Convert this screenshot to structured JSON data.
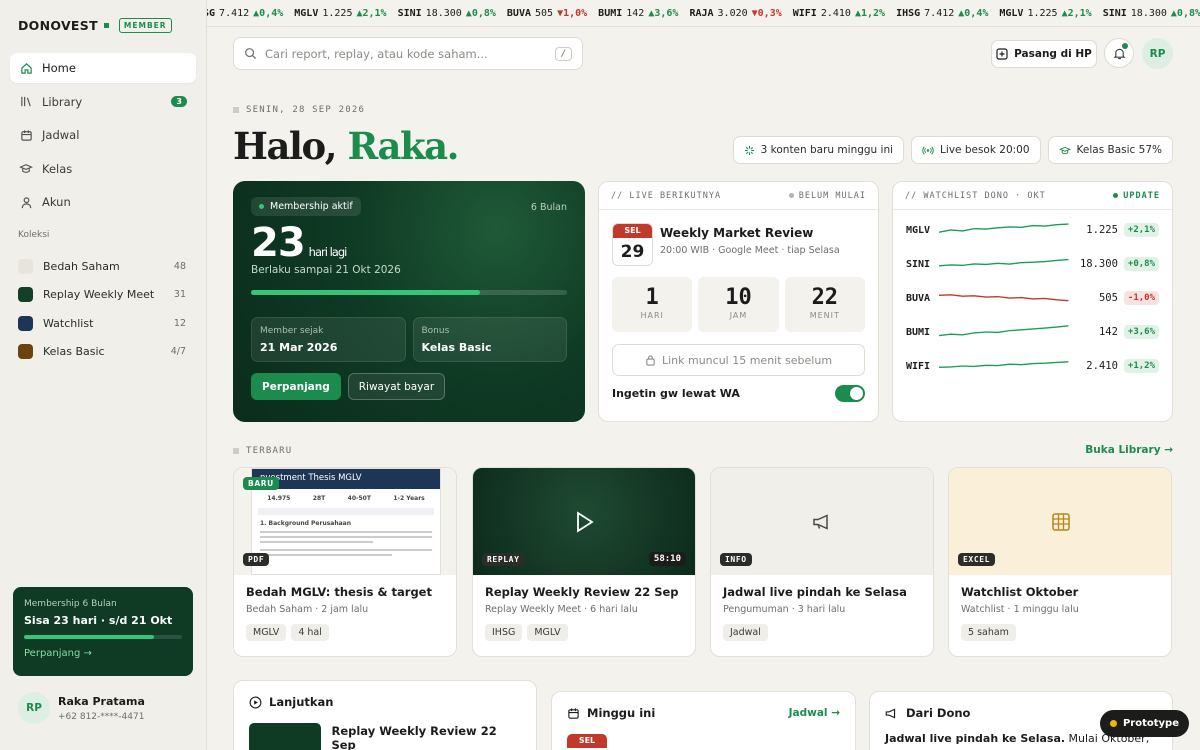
{
  "brand": {
    "name": "DONOVEST",
    "badge": "MEMBER"
  },
  "nav": [
    {
      "label": "Home",
      "icon": "home-icon",
      "active": true
    },
    {
      "label": "Library",
      "icon": "library-icon",
      "count": "3"
    },
    {
      "label": "Jadwal",
      "icon": "calendar-icon"
    },
    {
      "label": "Kelas",
      "icon": "graduation-cap-icon"
    },
    {
      "label": "Akun",
      "icon": "user-icon"
    }
  ],
  "collections": {
    "title": "Koleksi",
    "items": [
      {
        "label": "Bedah Saham",
        "count": "48",
        "color": "#e8e4dc"
      },
      {
        "label": "Replay Weekly Meet",
        "count": "31",
        "color": "#123f28"
      },
      {
        "label": "Watchlist",
        "count": "12",
        "color": "#1d3557"
      },
      {
        "label": "Kelas Basic",
        "count": "4/7",
        "color": "#6b4310"
      }
    ]
  },
  "side_card": {
    "title": "Membership 6 Bulan",
    "main": "Sisa 23 hari · s/d 21 Okt",
    "progress": 0.82,
    "link": "Perpanjang →"
  },
  "user": {
    "initials": "RP",
    "name": "Raka Pratama",
    "phone": "+62 812-****-4471"
  },
  "ticker": [
    {
      "s": "SG",
      "p": "7.412",
      "c": "▲0,4%",
      "d": "up"
    },
    {
      "s": "MGLV",
      "p": "1.225",
      "c": "▲2,1%",
      "d": "up"
    },
    {
      "s": "SINI",
      "p": "18.300",
      "c": "▲0,8%",
      "d": "up"
    },
    {
      "s": "BUVA",
      "p": "505",
      "c": "▼1,0%",
      "d": "dn"
    },
    {
      "s": "BUMI",
      "p": "142",
      "c": "▲3,6%",
      "d": "up"
    },
    {
      "s": "RAJA",
      "p": "3.020",
      "c": "▼0,3%",
      "d": "dn"
    },
    {
      "s": "WIFI",
      "p": "2.410",
      "c": "▲1,2%",
      "d": "up"
    },
    {
      "s": "IHSG",
      "p": "7.412",
      "c": "▲0,4%",
      "d": "up"
    },
    {
      "s": "MGLV",
      "p": "1.225",
      "c": "▲2,1%",
      "d": "up"
    },
    {
      "s": "SINI",
      "p": "18.300",
      "c": "▲0,8%",
      "d": "up"
    }
  ],
  "search": {
    "placeholder": "Cari report, replay, atau kode saham...",
    "kbd": "/"
  },
  "header": {
    "pair_label": "Pasang di HP",
    "avatar": "RP"
  },
  "greeting": {
    "date": "SENIN, 28 SEP 2026",
    "hello": "Halo,",
    "name": "Raka."
  },
  "chips": [
    {
      "label": "3 konten baru minggu ini",
      "icon": "sparkle-icon"
    },
    {
      "label": "Live besok 20:00",
      "icon": "broadcast-icon"
    },
    {
      "label": "Kelas Basic 57%",
      "icon": "graduation-cap-icon"
    }
  ],
  "membership": {
    "pill": "Membership aktif",
    "duration": "6 Bulan",
    "days": "23",
    "days_label": "hari lagi",
    "valid": "Berlaku sampai 21 Okt 2026",
    "since_label": "Member sejak",
    "since": "21 Mar 2026",
    "bonus_label": "Bonus",
    "bonus": "Kelas Basic",
    "renew": "Perpanjang",
    "history": "Riwayat bayar"
  },
  "live": {
    "header": "// LIVE BERIKUTNYA",
    "status": "BELUM MULAI",
    "month": "SEL",
    "day": "29",
    "title": "Weekly Market Review",
    "sub": "20:00 WIB · Google Meet · tiap Selasa",
    "countdown": [
      {
        "n": "1",
        "l": "HARI"
      },
      {
        "n": "10",
        "l": "JAM"
      },
      {
        "n": "22",
        "l": "MENIT"
      }
    ],
    "link": "Link muncul 15 menit sebelum",
    "wa": "Ingetin gw lewat WA"
  },
  "watchlist": {
    "header": "// WATCHLIST DONO · OKT",
    "status": "UPDATE",
    "rows": [
      {
        "s": "MGLV",
        "p": "1.225",
        "c": "+2,1%",
        "d": "up",
        "spark": [
          0.62,
          0.5,
          0.55,
          0.42,
          0.45,
          0.38,
          0.33,
          0.35,
          0.25,
          0.28,
          0.2,
          0.16
        ]
      },
      {
        "s": "SINI",
        "p": "18.300",
        "c": "+0,8%",
        "d": "up",
        "spark": [
          0.6,
          0.55,
          0.58,
          0.5,
          0.53,
          0.46,
          0.5,
          0.42,
          0.4,
          0.36,
          0.3,
          0.25
        ]
      },
      {
        "s": "BUVA",
        "p": "505",
        "c": "-1,0%",
        "d": "dn",
        "spark": [
          0.35,
          0.32,
          0.4,
          0.38,
          0.45,
          0.42,
          0.5,
          0.48,
          0.55,
          0.52,
          0.6,
          0.65
        ]
      },
      {
        "s": "BUMI",
        "p": "142",
        "c": "+3,6%",
        "d": "up",
        "spark": [
          0.7,
          0.62,
          0.66,
          0.55,
          0.5,
          0.52,
          0.42,
          0.38,
          0.33,
          0.28,
          0.22,
          0.15
        ]
      },
      {
        "s": "WIFI",
        "p": "2.410",
        "c": "+1,2%",
        "d": "up",
        "spark": [
          0.58,
          0.55,
          0.5,
          0.52,
          0.46,
          0.48,
          0.4,
          0.42,
          0.36,
          0.34,
          0.3,
          0.26
        ]
      }
    ]
  },
  "recent": {
    "title": "TERBARU",
    "link": "Buka Library →",
    "cards": [
      {
        "badge": "PDF",
        "new": "BARU",
        "title": "Bedah MGLV: thesis & target",
        "sub": "Bedah Saham · 2 jam lalu",
        "tags": [
          "MGLV",
          "4 hal"
        ],
        "doc_title": "nvestment Thesis MGLV",
        "doc_cols": [
          "14.975",
          "28T",
          "40-50T",
          "1-2 Years"
        ],
        "doc_sec": "1. Background Perusahaan"
      },
      {
        "badge": "REPLAY",
        "duration": "58:10",
        "title": "Replay Weekly Review 22 Sep",
        "sub": "Replay Weekly Meet · 6 hari lalu",
        "tags": [
          "IHSG",
          "MGLV"
        ]
      },
      {
        "badge": "INFO",
        "title": "Jadwal live pindah ke Selasa",
        "sub": "Pengumuman · 3 hari lalu",
        "tags": [
          "Jadwal"
        ]
      },
      {
        "badge": "EXCEL",
        "title": "Watchlist Oktober",
        "sub": "Watchlist · 1 minggu lalu",
        "tags": [
          "5 saham"
        ]
      }
    ]
  },
  "continue": {
    "title": "Lanjutkan",
    "item": "Replay Weekly Review 22 Sep"
  },
  "week": {
    "title": "Minggu ini",
    "link": "Jadwal →",
    "month": "SEL"
  },
  "dono": {
    "title": "Dari Dono",
    "text_bold": "Jadwal live pindah ke Selasa.",
    "text": " Mulai Oktober,"
  },
  "prototype": "Prototype"
}
